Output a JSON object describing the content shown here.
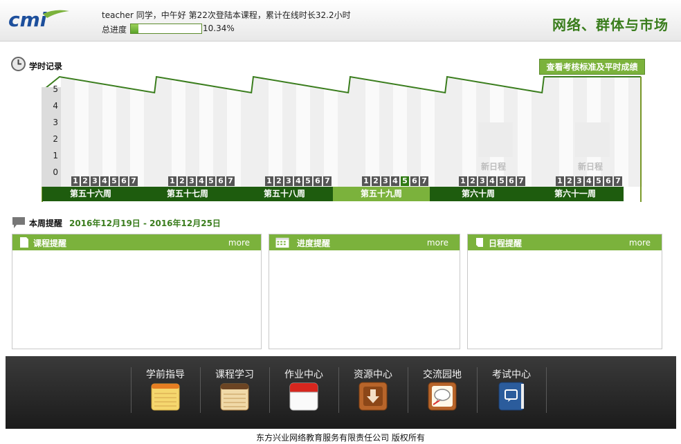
{
  "header": {
    "logo_text": "cmi",
    "greeting": "teacher 同学，中午好  第22次登陆本课程，累计在线时长32.2小时",
    "progress_label": "总进度",
    "progress_percent": 10.34,
    "progress_text": "10.34%",
    "course_title": "网络、群体与市场"
  },
  "study_record": {
    "title": "学时记录",
    "check_button": "查看考核标准及平时成绩",
    "y_ticks": [
      "5",
      "4",
      "3",
      "2",
      "1",
      "0"
    ],
    "day_numbers": [
      "1",
      "2",
      "3",
      "4",
      "5",
      "6",
      "7"
    ],
    "weeks": [
      {
        "label": "第五十六周",
        "active": false,
        "active_day": null,
        "new_schedule": ""
      },
      {
        "label": "第五十七周",
        "active": false,
        "active_day": null,
        "new_schedule": ""
      },
      {
        "label": "第五十八周",
        "active": false,
        "active_day": null,
        "new_schedule": ""
      },
      {
        "label": "第五十九周",
        "active": true,
        "active_day": 5,
        "new_schedule": ""
      },
      {
        "label": "第六十周",
        "active": false,
        "active_day": null,
        "new_schedule": "新日程"
      },
      {
        "label": "第六十一周",
        "active": false,
        "active_day": null,
        "new_schedule": "新日程"
      }
    ]
  },
  "reminders": {
    "title": "本周提醒",
    "date_range": "2016年12月19日  - 2016年12月25日",
    "panels": [
      {
        "title": "课程提醒",
        "more": "more",
        "icon": "document-icon"
      },
      {
        "title": "进度提醒",
        "more": "more",
        "icon": "calendar-icon"
      },
      {
        "title": "日程提醒",
        "more": "more",
        "icon": "note-icon"
      }
    ]
  },
  "nav": {
    "items": [
      {
        "label": "学前指导",
        "icon": "notepad-icon"
      },
      {
        "label": "课程学习",
        "icon": "legal-pad-icon"
      },
      {
        "label": "作业中心",
        "icon": "calendar-icon"
      },
      {
        "label": "资源中心",
        "icon": "download-icon"
      },
      {
        "label": "交流园地",
        "icon": "chat-icon"
      },
      {
        "label": "考试中心",
        "icon": "book-icon"
      }
    ]
  },
  "footer": {
    "text": "东方兴业网络教育服务有限责任公司     版权所有"
  },
  "colors": {
    "accent": "#7bb23c",
    "dark_green": "#1e5c0e",
    "title_green": "#3a7d1d"
  }
}
